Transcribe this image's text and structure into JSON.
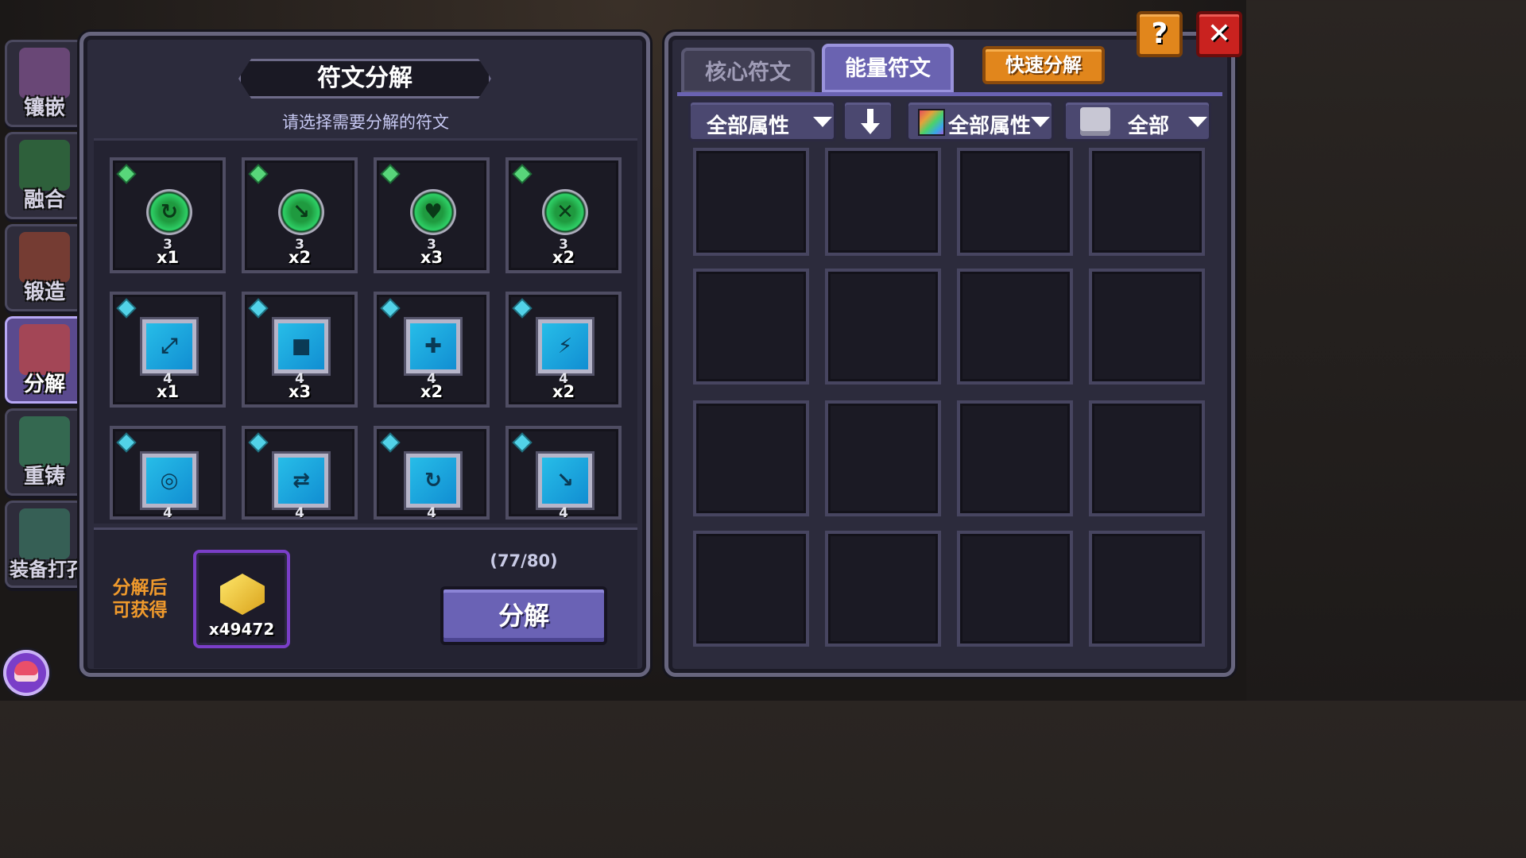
{
  "side_nav": [
    {
      "label": "镶嵌",
      "active": false,
      "art": "#9a5fa8"
    },
    {
      "label": "融合",
      "active": false,
      "art": "#2f8d3c"
    },
    {
      "label": "锻造",
      "active": false,
      "art": "#b04a2e"
    },
    {
      "label": "分解",
      "active": true,
      "art": "#e04428"
    },
    {
      "label": "重铸",
      "active": false,
      "art": "#3a9a62"
    },
    {
      "label": "装备打孔",
      "active": false,
      "art": "#3e8a6c"
    }
  ],
  "left_panel": {
    "title": "符文分解",
    "subtitle": "请选择需要分解的符文",
    "runes": [
      {
        "type": "green",
        "glyph": "↻",
        "level": "3",
        "count": "x1"
      },
      {
        "type": "green",
        "glyph": "↘",
        "level": "3",
        "count": "x2"
      },
      {
        "type": "green",
        "glyph": "♥",
        "level": "3",
        "count": "x3"
      },
      {
        "type": "green",
        "glyph": "✕",
        "level": "3",
        "count": "x2"
      },
      {
        "type": "cyan",
        "glyph": "⤢",
        "level": "4",
        "count": "x1"
      },
      {
        "type": "cyan",
        "glyph": "■",
        "level": "4",
        "count": "x3"
      },
      {
        "type": "cyan",
        "glyph": "✚",
        "level": "4",
        "count": "x2"
      },
      {
        "type": "cyan",
        "glyph": "⚡",
        "level": "4",
        "count": "x2"
      },
      {
        "type": "cyan",
        "glyph": "◎",
        "level": "4",
        "count": ""
      },
      {
        "type": "cyan",
        "glyph": "⇄",
        "level": "4",
        "count": ""
      },
      {
        "type": "cyan",
        "glyph": "↻",
        "level": "4",
        "count": ""
      },
      {
        "type": "cyan",
        "glyph": "↘",
        "level": "4",
        "count": ""
      }
    ],
    "reward_label_1": "分解后",
    "reward_label_2": "可获得",
    "reward_icon": "gold-material-icon",
    "reward_count": "x49472",
    "capacity": "(77/80)",
    "decompose_button": "分解"
  },
  "right_panel": {
    "tabs": [
      {
        "label": "核心符文",
        "active": false
      },
      {
        "label": "能量符文",
        "active": true
      }
    ],
    "quick_button": "快速分解",
    "filters": {
      "attribute": "全部属性",
      "sort_icon": "sort-down-arrow-icon",
      "color_attribute": "全部属性",
      "type": "全部"
    },
    "inventory_rows": 4,
    "inventory_cols": 4
  },
  "corner": {
    "help_label": "?",
    "close_label": "✕"
  },
  "colors": {
    "accent_purple": "#6a62b5",
    "orange": "#e1861c",
    "close_red": "#c9221f"
  }
}
